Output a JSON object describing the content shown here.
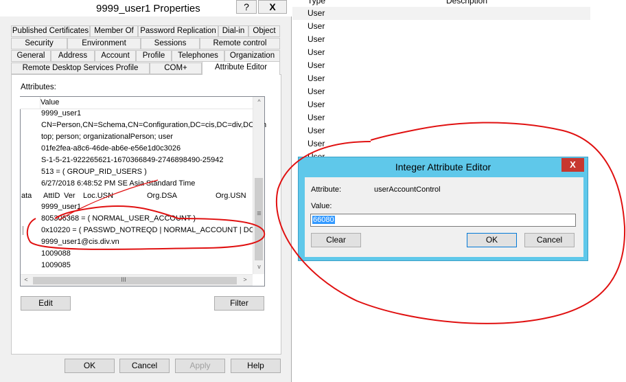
{
  "props_dialog": {
    "title": "9999_user1 Properties",
    "help_caption": "?",
    "close_caption": "X",
    "tab_rows": [
      [
        "Published Certificates",
        "Member Of",
        "Password Replication",
        "Dial-in",
        "Object"
      ],
      [
        "Security",
        "Environment",
        "Sessions",
        "Remote control"
      ],
      [
        "General",
        "Address",
        "Account",
        "Profile",
        "Telephones",
        "Organization"
      ],
      [
        "Remote Desktop Services Profile",
        "COM+",
        "Attribute Editor"
      ]
    ],
    "attributes_label": "Attributes:",
    "column_header": "Value",
    "rows": [
      "9999_user1",
      "CN=Person,CN=Schema,CN=Configuration,DC=cis,DC=div,DC=vn",
      "top; person; organizationalPerson; user",
      "01fe2fea-a8c6-46de-ab6e-e56e1d0c3026",
      "S-1-5-21-922265621-1670366849-2746898490-25942",
      "513 = ( GROUP_RID_USERS )",
      "6/27/2018 6:48:52 PM SE Asia Standard Time",
      "",
      "9999_user1",
      "805306368 = ( NORMAL_USER_ACCOUNT )",
      "0x10220 = ( PASSWD_NOTREQD | NORMAL_ACCOUNT | DON",
      "9999_user1@cis.div.vn",
      "1009088",
      "1009085"
    ],
    "meta_row": {
      "c1": "ata",
      "c2": "AttID",
      "c3": "Ver",
      "c4": "Loc.USN",
      "c5": "Org.DSA",
      "c6": "Org.USN"
    },
    "edit_button": "Edit",
    "filter_button": "Filter",
    "ok_button": "OK",
    "cancel_button": "Cancel",
    "apply_button": "Apply",
    "help_button": "Help",
    "scroll_glyphs": {
      "up": "^",
      "down": "v",
      "left": "<",
      "right": ">",
      "hthumb": "III",
      "vthumb": "≡"
    }
  },
  "bg_window": {
    "col_type": "Type",
    "col_desc": "Description",
    "rows": [
      "User",
      "User",
      "User",
      "User",
      "User",
      "User",
      "User",
      "User",
      "User",
      "User",
      "User",
      "User"
    ]
  },
  "int_editor": {
    "title": "Integer Attribute Editor",
    "close_glyph": "X",
    "attribute_label": "Attribute:",
    "attribute_value": "userAccountControl",
    "value_label": "Value:",
    "value": "66080",
    "clear_button": "Clear",
    "ok_button": "OK",
    "cancel_button": "Cancel"
  },
  "colors": {
    "editor_frame": "#5fc8ea",
    "close_red": "#c7372f",
    "annotation_red": "#e01010",
    "selection": "#3399ff"
  }
}
